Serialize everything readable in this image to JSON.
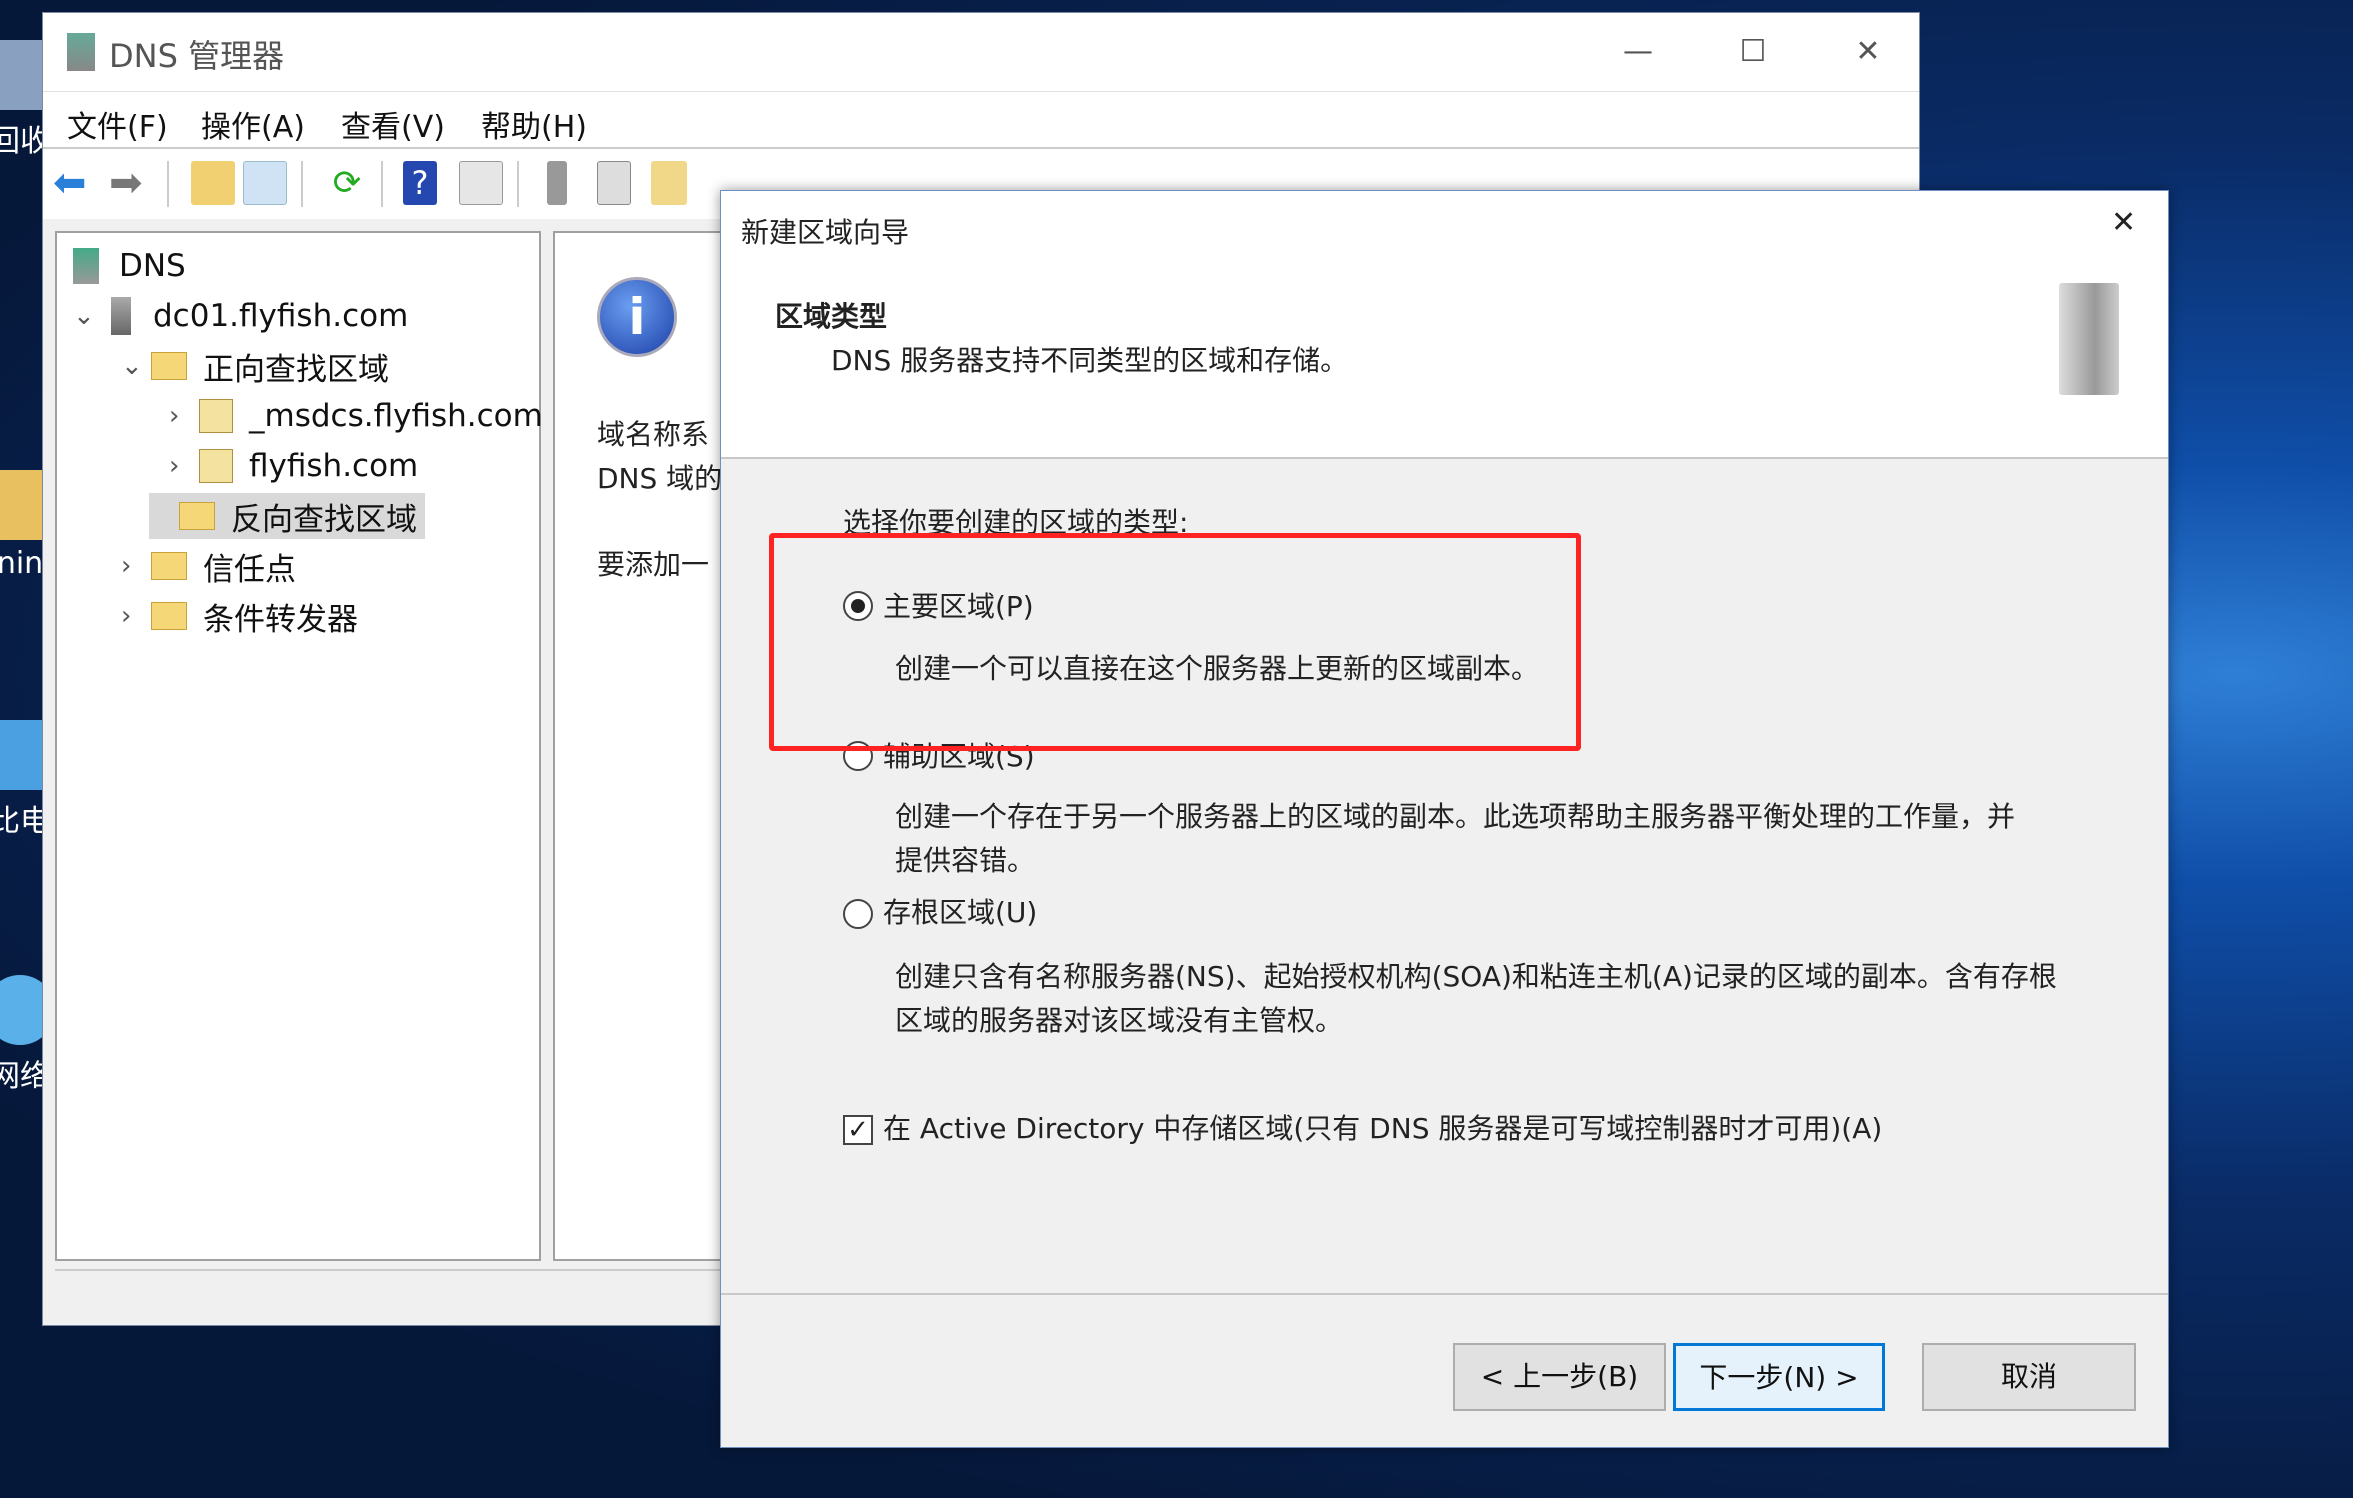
{
  "desktop": {
    "icons": [
      {
        "label": "回收"
      },
      {
        "label": "nin"
      },
      {
        "label": "比电"
      },
      {
        "label": "网络"
      }
    ]
  },
  "window": {
    "title": "DNS 管理器",
    "controls": {
      "minimize": "—",
      "maximize": "☐",
      "close": "✕"
    },
    "menu": [
      "文件(F)",
      "操作(A)",
      "查看(V)",
      "帮助(H)"
    ],
    "toolbar": [
      "back-icon",
      "forward-icon",
      "up-folder-icon",
      "show-hide-tree-icon",
      "refresh-icon",
      "help-icon",
      "action-pane-icon",
      "server-icon",
      "list-icon",
      "zone-icon"
    ],
    "tree": {
      "root": "DNS",
      "server": "dc01.flyfish.com",
      "forward": "正向查找区域",
      "zones": [
        "_msdcs.flyfish.com",
        "flyfish.com"
      ],
      "reverse": "反向查找区域",
      "trust": "信任点",
      "forwarders": "条件转发器"
    },
    "info_pane": {
      "line1": "域名称系",
      "line2": "DNS 域的",
      "line3": "要添加一"
    }
  },
  "dialog": {
    "title": "新建区域向导",
    "close": "✕",
    "header_title": "区域类型",
    "header_subtitle": "DNS 服务器支持不同类型的区域和存储。",
    "prompt": "选择你要创建的区域的类型:",
    "options": [
      {
        "label": "主要区域(P)",
        "desc": "创建一个可以直接在这个服务器上更新的区域副本。",
        "selected": true
      },
      {
        "label": "辅助区域(S)",
        "desc": "创建一个存在于另一个服务器上的区域的副本。此选项帮助主服务器平衡处理的工作量，并提供容错。",
        "selected": false
      },
      {
        "label": "存根区域(U)",
        "desc": "创建只含有名称服务器(NS)、起始授权机构(SOA)和粘连主机(A)记录的区域的副本。含有存根区域的服务器对该区域没有主管权。",
        "selected": false
      }
    ],
    "ad_checkbox": {
      "label": "在 Active Directory 中存储区域(只有 DNS 服务器是可写域控制器时才可用)(A)",
      "checked": true
    },
    "buttons": {
      "back": "< 上一步(B)",
      "next": "下一步(N) >",
      "cancel": "取消"
    },
    "highlight_color": "#ff2222"
  }
}
